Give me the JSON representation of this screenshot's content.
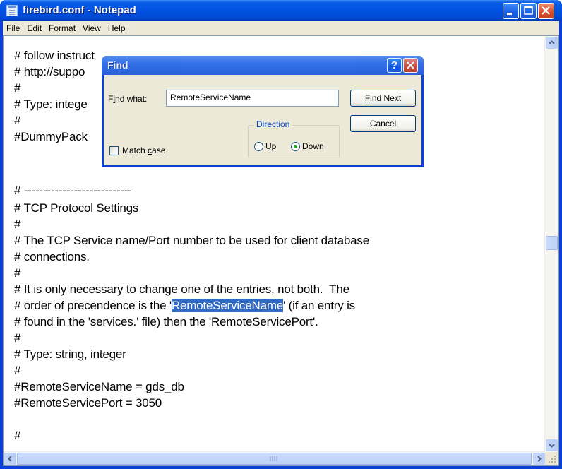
{
  "window": {
    "title": "firebird.conf - Notepad"
  },
  "menu": [
    {
      "label": "File"
    },
    {
      "label": "Edit"
    },
    {
      "label": "Format"
    },
    {
      "label": "View"
    },
    {
      "label": "Help"
    }
  ],
  "editor": {
    "lines": [
      "# follow instruct",
      "# http://suppo",
      "#",
      "# Type: intege",
      "#",
      "#DummyPack",
      "",
      "",
      "# ----------------------------",
      "# TCP Protocol Settings",
      "#",
      "# The TCP Service name/Port number to be used for client database",
      "# connections.",
      "#",
      "# It is only necessary to change one of the entries, not both.  The",
      "# order of precendence is the '",
      "# found in the 'services.' file) then the 'RemoteServicePort'.",
      "#",
      "# Type: string, integer",
      "#",
      "#RemoteServiceName = gds_db",
      "#RemoteServicePort = 3050",
      "",
      "#"
    ],
    "highlight_line": {
      "before": "# order of precendence is the '",
      "selected": "RemoteServiceName",
      "after": "' (if an entry is"
    }
  },
  "find_dialog": {
    "title": "Find",
    "help_label": "?",
    "find_what_label": "Find what:",
    "find_what_value": "RemoteServiceName",
    "find_next_label": "Find Next",
    "cancel_label": "Cancel",
    "direction_label": "Direction",
    "up_label": "Up",
    "down_label": "Down",
    "direction_selected": "Down",
    "match_case_label": "Match case",
    "match_case_checked": false
  },
  "colors": {
    "titlebar": "#0054e3",
    "selection": "#316ac5",
    "dialog_face": "#ece9d8"
  }
}
